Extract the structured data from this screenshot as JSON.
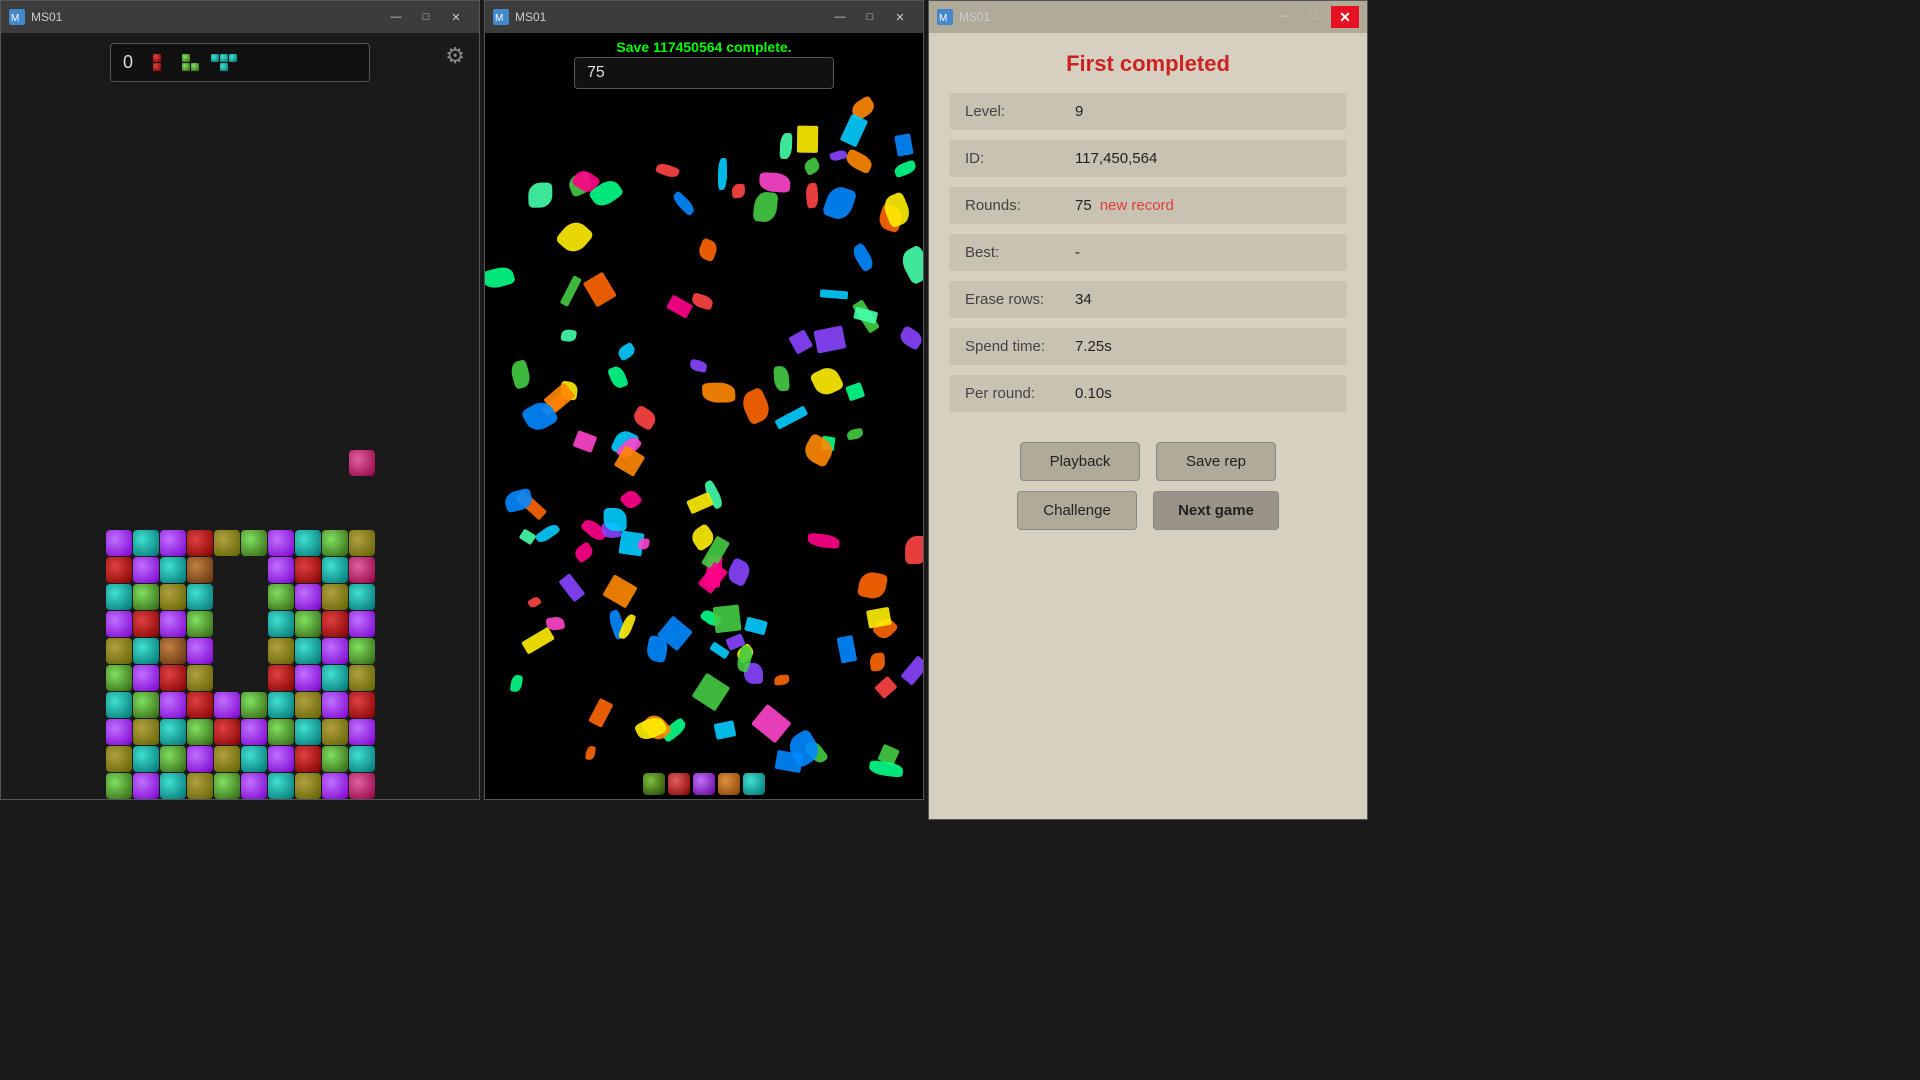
{
  "windows": {
    "left": {
      "title": "MS01",
      "score": "0",
      "controls": {
        "minimize": "—",
        "maximize": "□",
        "close": "✕"
      }
    },
    "middle": {
      "title": "MS01",
      "score": "75",
      "complete_text": "Save 117450564 complete.",
      "controls": {
        "minimize": "—",
        "maximize": "□",
        "close": "✕"
      }
    },
    "right": {
      "title": "MS01",
      "controls": {
        "minimize": "—",
        "maximize": "□",
        "close": "✕"
      },
      "panel": {
        "title": "First completed",
        "rows": [
          {
            "label": "Level:",
            "value": "9"
          },
          {
            "label": "ID:",
            "value": "117,450,564"
          },
          {
            "label": "Rounds:",
            "value": "75",
            "extra": "new record"
          },
          {
            "label": "Best:",
            "value": "-"
          },
          {
            "label": "Erase rows:",
            "value": "34"
          },
          {
            "label": "Spend time:",
            "value": "7.25s"
          },
          {
            "label": "Per round:",
            "value": "0.10s"
          }
        ],
        "buttons": {
          "playback": "Playback",
          "save_rep": "Save rep",
          "challenge": "Challenge",
          "next_game": "Next game"
        }
      }
    }
  }
}
